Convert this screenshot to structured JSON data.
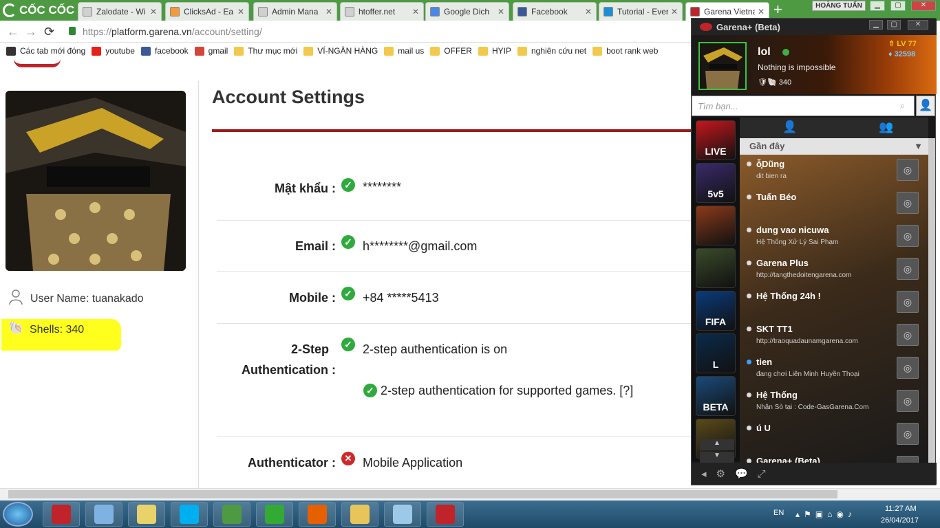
{
  "browser": {
    "brand": "CỐC CỐC",
    "tabs": [
      {
        "label": "Zalodate - Wi",
        "fav": "#d0d0d0"
      },
      {
        "label": "ClicksAd - Ea",
        "fav": "#f29b38"
      },
      {
        "label": "Admin Mana",
        "fav": "#d0d0d0"
      },
      {
        "label": "htoffer.net",
        "fav": "#d0d0d0"
      },
      {
        "label": "Google Dich",
        "fav": "#4a86e8"
      },
      {
        "label": "Facebook",
        "fav": "#3b5998"
      },
      {
        "label": "Tutorial - Ever",
        "fav": "#1f8dd6"
      },
      {
        "label": "Garena Vietna",
        "fav": "#c0242a"
      }
    ],
    "profile_name": "HOÀNG TUẤN",
    "url_scheme": "https://",
    "url_host": "platform.garena.vn",
    "url_path": "/account/setting/",
    "bookmarks": [
      {
        "label": "Các tab mới đóng",
        "color": "#333333"
      },
      {
        "label": "youtube",
        "color": "#e62117"
      },
      {
        "label": "facebook",
        "color": "#3b5998"
      },
      {
        "label": "gmail",
        "color": "#d44638"
      },
      {
        "label": "Thư mục mới",
        "color": "#f2c94c"
      },
      {
        "label": "VÍ-NGÂN HÀNG",
        "color": "#f2c94c"
      },
      {
        "label": "mail us",
        "color": "#f2c94c"
      },
      {
        "label": "OFFER",
        "color": "#f2c94c"
      },
      {
        "label": "HYIP",
        "color": "#f2c94c"
      },
      {
        "label": "nghiên cứu net",
        "color": "#f2c94c"
      },
      {
        "label": "boot rank web",
        "color": "#f2c94c"
      }
    ]
  },
  "account": {
    "user_name": "User Name: tuanakado",
    "shells": "Shells: 340",
    "title": "Account Settings",
    "password_label": "Mật khẩu :",
    "password_value": "********",
    "email_label": "Email :",
    "email_value": "h********@gmail.com",
    "mobile_label": "Mobile :",
    "mobile_value": "+84 *****5413",
    "twostep_label_1": "2-Step",
    "twostep_label_2": "Authentication :",
    "twostep_value": "2-step authentication is on",
    "twostep_games": "2-step authentication for supported games. [?]",
    "authenticator_label": "Authenticator :",
    "authenticator_value": "Mobile Application"
  },
  "garena": {
    "title": "Garena+ (Beta)",
    "name": "lol",
    "status": "Nothing is impossible",
    "shells": "340",
    "level": "LV 77",
    "points": "32598",
    "search_placeholder": "Tìm bạn...",
    "recent_label": "Gần đây",
    "apps": [
      {
        "label": "LIVE",
        "color": "#c4161c"
      },
      {
        "label": "5v5",
        "color": "#3a2a6a"
      },
      {
        "label": "",
        "color": "#8a3a1a"
      },
      {
        "label": "",
        "color": "#3a4a2a"
      },
      {
        "label": "FIFA",
        "color": "#0a3a7a"
      },
      {
        "label": "L",
        "color": "#0a2a4a"
      },
      {
        "label": "BETA",
        "color": "#1a4a7a"
      },
      {
        "label": "",
        "color": "#5a4a1a"
      }
    ],
    "friends": [
      {
        "name": "ỗ̥Dũng",
        "sub": "dit bien ra",
        "online": false
      },
      {
        "name": "Tuấn Béo",
        "sub": "",
        "online": false
      },
      {
        "name": "dung vao nicuwa",
        "sub": "Hệ Thống Xử Lý Sai Phạm",
        "online": false
      },
      {
        "name": "Garena Plus",
        "sub": "http://tangthedoitengarena.com",
        "online": false
      },
      {
        "name": "Hệ Thống 24h !",
        "sub": "",
        "online": false
      },
      {
        "name": "SKT TT1",
        "sub": "http://traoquadaunamgarena.com",
        "online": false
      },
      {
        "name": "tien",
        "sub": "đang chơi Liên Minh Huyền Thoại",
        "online": true
      },
      {
        "name": "Hệ Thống",
        "sub": "Nhận Sò tại : Code-GasGarena.Com",
        "online": false
      },
      {
        "name": "ú U",
        "sub": "",
        "online": false
      },
      {
        "name": "Garena+ (Beta)",
        "sub": "",
        "online": false
      }
    ]
  },
  "taskbar": {
    "lang": "EN",
    "time": "11:27 AM",
    "date": "26/04/2017",
    "apps": [
      {
        "name": "garena",
        "color": "#c0242a"
      },
      {
        "name": "box",
        "color": "#7fb2e0"
      },
      {
        "name": "folder-mix",
        "color": "#e8d26a"
      },
      {
        "name": "skype",
        "color": "#00aff0"
      },
      {
        "name": "coccoc",
        "color": "#4d9a43"
      },
      {
        "name": "checkmark",
        "color": "#3a3"
      },
      {
        "name": "firefox",
        "color": "#e66000"
      },
      {
        "name": "explorer",
        "color": "#e8c55a"
      },
      {
        "name": "notepad",
        "color": "#9cc9e8"
      },
      {
        "name": "foxit",
        "color": "#c0242a"
      }
    ]
  }
}
